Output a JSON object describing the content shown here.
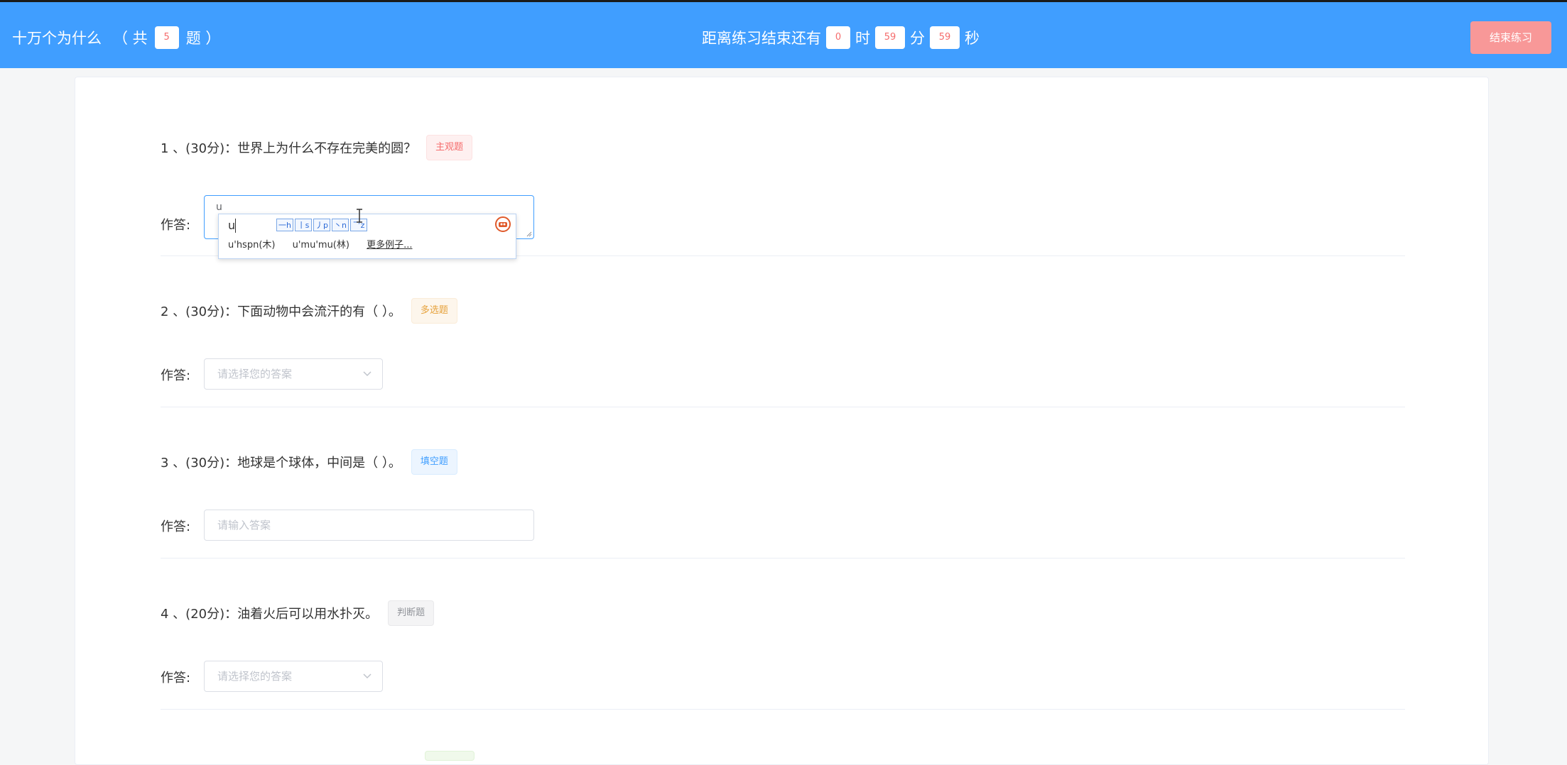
{
  "header": {
    "quiz_title": "十万个为什么",
    "total_prefix": "（ 共",
    "total_count": "5",
    "total_suffix": "题 ）",
    "countdown_label": "距离练习结束还有",
    "hours": "0",
    "hours_unit": "时",
    "minutes": "59",
    "minutes_unit": "分",
    "seconds": "59",
    "seconds_unit": "秒",
    "end_button": "结束练习"
  },
  "answer_label": "作答:",
  "questions": [
    {
      "title": "1 、(30分)：世界上为什么不存在完美的圆？",
      "tag": "主观题",
      "answer_value": "u"
    },
    {
      "title": "2 、(30分)：下面动物中会流汗的有（ ）。",
      "tag": "多选题",
      "placeholder": "请选择您的答案"
    },
    {
      "title": "3 、(30分)：地球是个球体，中间是（ ）。",
      "tag": "填空题",
      "placeholder": "请输入答案"
    },
    {
      "title": "4 、(20分)：油着火后可以用水扑灭。",
      "tag": "判断题",
      "placeholder": "请选择您的答案"
    }
  ],
  "ime": {
    "composition": "u",
    "strokes": [
      "一h",
      "丨s",
      "丿p",
      "丶n",
      "乛z"
    ],
    "candidates": [
      "u'hspn(木)",
      "u'mu'mu(林)"
    ],
    "more": "更多例子..."
  },
  "colors": {
    "header_bg": "#409eff",
    "end_button_bg": "#f89898",
    "tag_subjective": "#f56c6c",
    "tag_multi": "#e6a23c",
    "tag_blank": "#409eff",
    "tag_judge": "#909399"
  }
}
